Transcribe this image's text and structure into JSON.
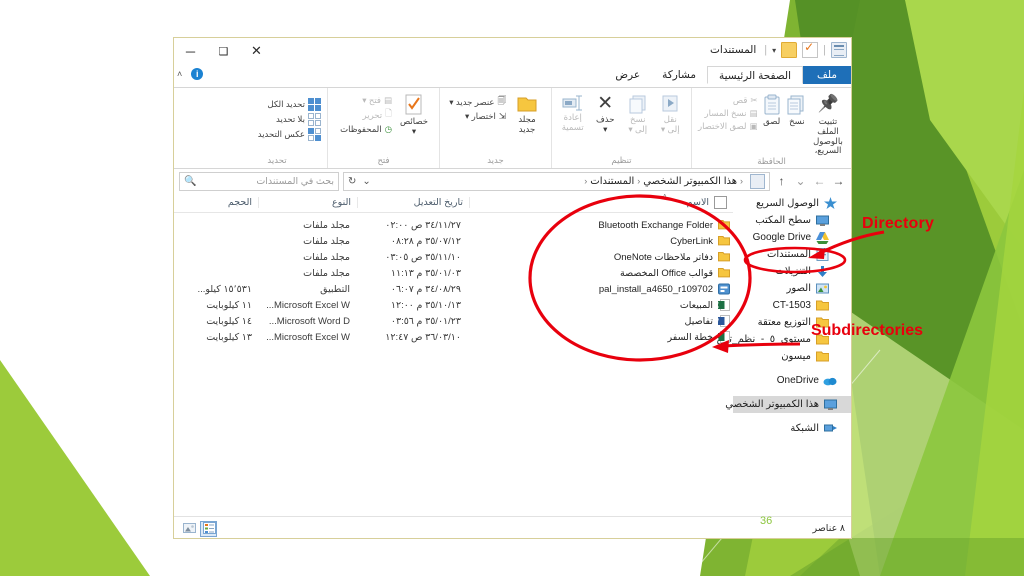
{
  "slide": {
    "number": "36",
    "background_colors": [
      "#8cc63e",
      "#a5d63f",
      "#6aa32b",
      "#4e8b24",
      "#b9de6c",
      "#d6ec9f"
    ]
  },
  "annotations": {
    "directory": "Directory",
    "subdirectories": "Subdirectories",
    "color": "#e8000d"
  },
  "window": {
    "title": "المستندات",
    "controls": {
      "close": "✕",
      "maximize": "❑",
      "minimize": "─"
    },
    "quick_access": {
      "properties_icon": "properties-icon",
      "new_folder_icon": "new-folder-icon",
      "customize_icon": "customize-qat-icon",
      "dropdown": "▾"
    },
    "help": {
      "icon": "help-icon",
      "glyph": "i",
      "collapse_ribbon": "˄"
    }
  },
  "ribbon": {
    "tabs": [
      {
        "label": "ملف",
        "kind": "file"
      },
      {
        "label": "الصفحة الرئيسية",
        "kind": "active"
      },
      {
        "label": "مشاركة",
        "kind": "normal"
      },
      {
        "label": "عرض",
        "kind": "normal"
      }
    ],
    "groups": [
      {
        "label": "الحافظة",
        "big": [
          {
            "label": "تثبيت الملف\nبالوصول السريع،",
            "icon": "pin-icon"
          },
          {
            "label": "نسخ",
            "icon": "copy-icon"
          },
          {
            "label": "لصق",
            "icon": "paste-icon"
          }
        ],
        "small": [
          {
            "label": "قص",
            "icon": "cut-icon"
          },
          {
            "label": "نسخ المسار",
            "icon": "copy-path-icon"
          },
          {
            "label": "لصق الاختصار",
            "icon": "paste-shortcut-icon"
          }
        ]
      },
      {
        "label": "تنظيم",
        "big": [
          {
            "label": "نقل\nإلى ▾",
            "icon": "move-to-icon"
          },
          {
            "label": "نسخ\nإلى ▾",
            "icon": "copy-to-icon"
          },
          {
            "label": "حذف\n▾",
            "icon": "delete-icon"
          },
          {
            "label": "إعادة\nتسمية",
            "icon": "rename-icon"
          }
        ],
        "small": []
      },
      {
        "label": "جديد",
        "big": [
          {
            "label": "مجلد\nجديد",
            "icon": "new-folder-icon"
          }
        ],
        "small": [
          {
            "label": "عنصر جديد ▾",
            "icon": "new-item-icon"
          },
          {
            "label": "اختصار ▾",
            "icon": "easy-access-icon"
          }
        ]
      },
      {
        "label": "فتح",
        "big": [
          {
            "label": "خصائص\n▾",
            "icon": "properties-icon"
          }
        ],
        "small": [
          {
            "label": "فتح ▾",
            "icon": "open-icon"
          },
          {
            "label": "تحرير",
            "icon": "edit-icon"
          },
          {
            "label": "المحفوظات",
            "icon": "history-icon"
          }
        ]
      },
      {
        "label": "تحديد",
        "big": [],
        "small": [
          {
            "label": "تحديد الكل",
            "icon": "select-all-icon"
          },
          {
            "label": "بلا تحديد",
            "icon": "select-none-icon"
          },
          {
            "label": "عكس التحديد",
            "icon": "invert-selection-icon"
          }
        ]
      }
    ]
  },
  "address_bar": {
    "forward": "→",
    "back": "←",
    "recent": "⌄",
    "up": "↑",
    "breadcrumb": [
      "هذا الكمبيوتر الشخصي",
      "المستندات"
    ],
    "breadcrumb_separator": "‹",
    "location_icon": "documents-icon",
    "dropdown": "⌄",
    "refresh": "↻",
    "search_placeholder": "بحث في المستندات",
    "search_value": "",
    "search_icon": "search-icon"
  },
  "nav_pane": {
    "items": [
      {
        "label": "الوصول السريع",
        "icon": "star-icon",
        "indent": false,
        "selected": false
      },
      {
        "label": "سطح المكتب",
        "icon": "desktop-icon",
        "indent": true,
        "selected": false,
        "pinned": true
      },
      {
        "label": "Google Drive",
        "icon": "google-drive-icon",
        "indent": true,
        "selected": false,
        "pinned": true
      },
      {
        "label": "المستندات",
        "icon": "documents-icon",
        "indent": true,
        "selected": false,
        "pinned": true
      },
      {
        "label": "التنزيلات",
        "icon": "downloads-icon",
        "indent": true,
        "selected": false,
        "pinned": true
      },
      {
        "label": "الصور",
        "icon": "pictures-icon",
        "indent": true,
        "selected": false,
        "pinned": true
      },
      {
        "label": "CT-1503",
        "icon": "folder-icon",
        "indent": true,
        "selected": false
      },
      {
        "label": "التوزيع معتقة",
        "icon": "folder-icon",
        "indent": true,
        "selected": false
      },
      {
        "label": "مستوى_٥_-_نظم_تش",
        "icon": "folder-icon",
        "indent": true,
        "selected": false
      },
      {
        "label": "ميسون",
        "icon": "folder-icon",
        "indent": true,
        "selected": false
      },
      {
        "label": "OneDrive",
        "icon": "onedrive-icon",
        "indent": false,
        "selected": false,
        "gap_before": true
      },
      {
        "label": "هذا الكمبيوتر الشخصي",
        "icon": "this-pc-icon",
        "indent": false,
        "selected": true,
        "gap_before": true
      },
      {
        "label": "الشبكة",
        "icon": "network-icon",
        "indent": false,
        "selected": false,
        "gap_before": true
      }
    ]
  },
  "file_list": {
    "columns": {
      "name": "الاسم",
      "date": "تاريخ التعديل",
      "type": "النوع",
      "size": "الحجم"
    },
    "sort_indicator": "˄",
    "select_all_checkbox": false,
    "rows": [
      {
        "name": "Bluetooth Exchange Folder",
        "date": "٣٤/١١/٢٧ ص ٠٢:٠٠",
        "type": "مجلد ملفات",
        "size": "",
        "icon": "folder-icon"
      },
      {
        "name": "CyberLink",
        "date": "٣٥/٠٧/١٢ م ٠٨:٢٨",
        "type": "مجلد ملفات",
        "size": "",
        "icon": "folder-icon"
      },
      {
        "name": "دفاتر ملاحظات OneNote",
        "date": "٣٥/١١/١٠ ص ٠٣:٠٥",
        "type": "مجلد ملفات",
        "size": "",
        "icon": "folder-icon"
      },
      {
        "name": "قوالب Office المخصصة",
        "date": "٣٥/٠١/٠٣ م ١١:١٣",
        "type": "مجلد ملفات",
        "size": "",
        "icon": "folder-icon"
      },
      {
        "name": "pal_install_a4650_r109702",
        "date": "٣٤/٠٨/٢٩ م ٠٦:٠٧",
        "type": "التطبيق",
        "size": "١٥٬٥٣١ كيلو...",
        "icon": "application-icon"
      },
      {
        "name": "المبيعات",
        "date": "٣٥/١٠/١٣ م ١٢:٠٠",
        "type": "Microsoft Excel W...",
        "size": "١١ كيلوبايت",
        "icon": "excel-icon"
      },
      {
        "name": "تفاصيل",
        "date": "٣٥/٠١/٢٣ م ٠٣:٥٦",
        "type": "Microsoft Word D...",
        "size": "١٤ كيلوبايت",
        "icon": "word-icon"
      },
      {
        "name": "خطة السفر",
        "date": "٣٦/٠٣/١٠ ص ١٢:٤٧",
        "type": "Microsoft Excel W...",
        "size": "١٣ كيلوبايت",
        "icon": "excel-icon"
      }
    ]
  },
  "status_bar": {
    "item_count": "٨ عناصر",
    "view_details_icon": "details-view-icon",
    "view_large_icon": "large-icons-view-icon"
  }
}
